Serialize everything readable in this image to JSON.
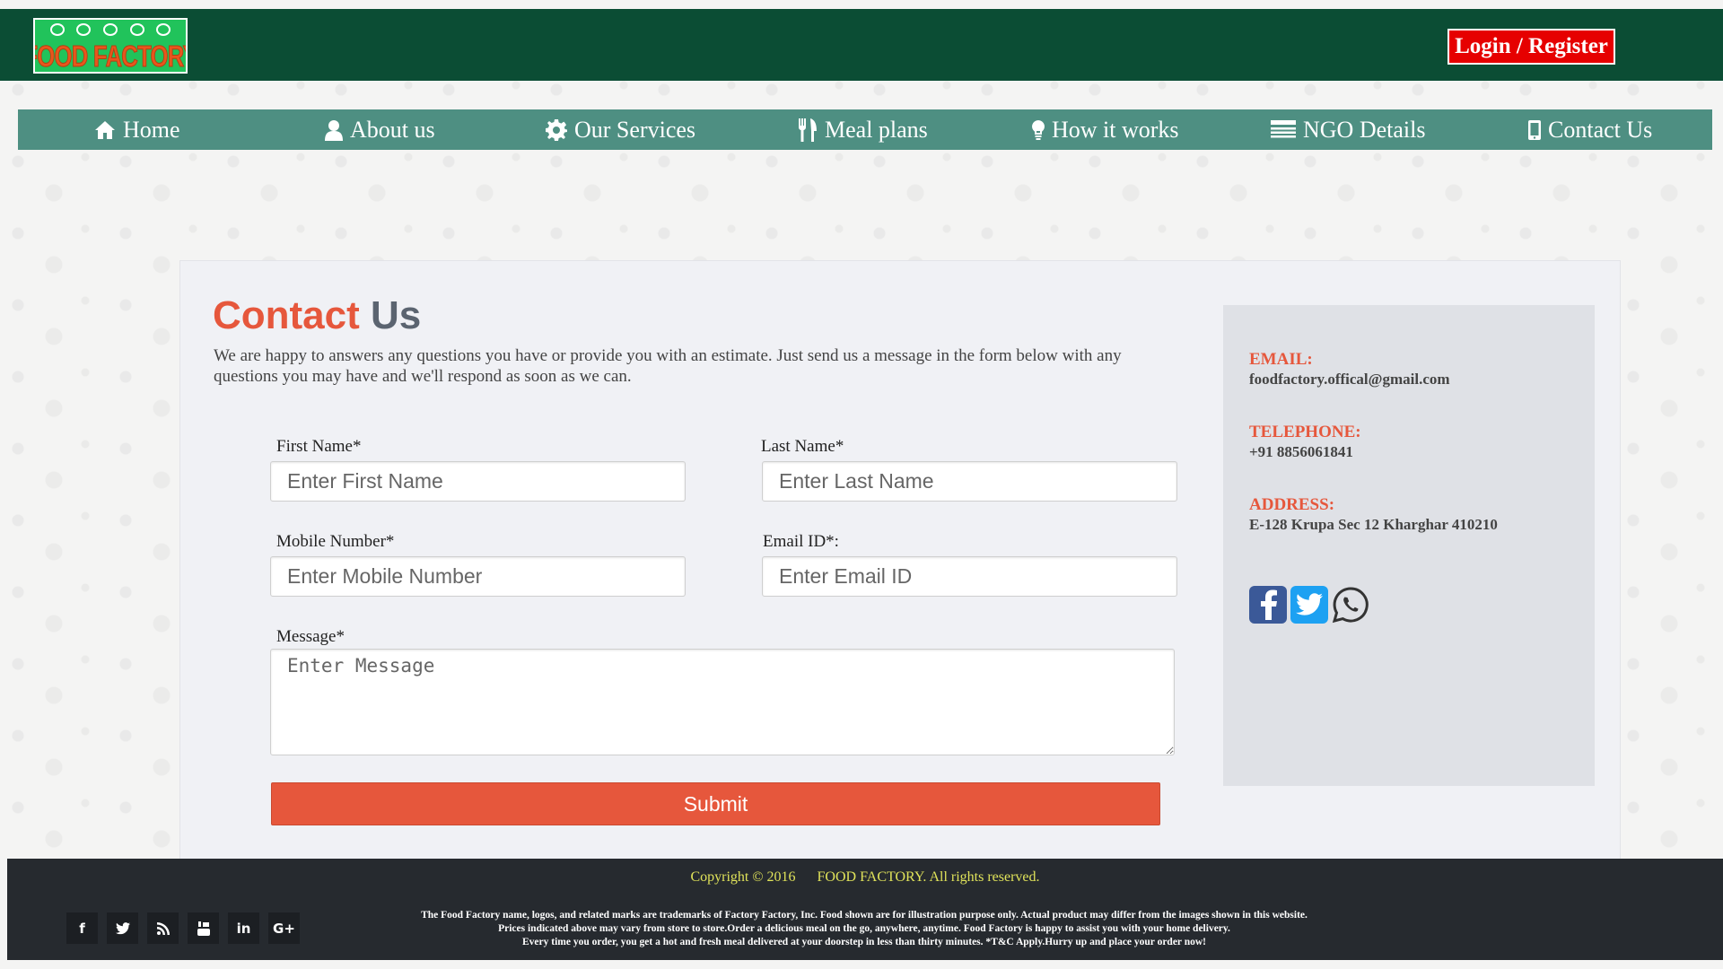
{
  "header": {
    "logo_text": "FOOD FACTORY",
    "login_label": "Login / Register"
  },
  "nav": {
    "items": [
      {
        "label": "Home",
        "icon": "home-icon"
      },
      {
        "label": "About us",
        "icon": "user-icon"
      },
      {
        "label": "Our Services",
        "icon": "gear-icon"
      },
      {
        "label": "Meal plans",
        "icon": "cutlery-icon"
      },
      {
        "label": "How it works",
        "icon": "lightbulb-icon"
      },
      {
        "label": "NGO Details",
        "icon": "list-icon"
      },
      {
        "label": "Contact Us",
        "icon": "mobile-icon"
      }
    ]
  },
  "contact": {
    "title_part1": "Contact",
    "title_part2": "Us",
    "intro": "We are happy to answers any questions you have or provide you with an estimate. Just send us a message in the form below with any questions you may have and we'll respond as soon as we can.",
    "first_name_label": "First Name*",
    "first_name_placeholder": "Enter First Name",
    "last_name_label": "Last Name*",
    "last_name_placeholder": "Enter Last Name",
    "mobile_label": "Mobile Number*",
    "mobile_placeholder": "Enter Mobile Number",
    "email_label": "Email ID*:",
    "email_placeholder": "Enter Email ID",
    "message_label": "Message*",
    "message_placeholder": "Enter Message",
    "submit_label": "Submit"
  },
  "info": {
    "email_heading": "EMAIL:",
    "email_value": "foodfactory.offical@gmail.com",
    "phone_heading": "TELEPHONE:",
    "phone_value": "+91 8856061841",
    "address_heading": "ADDRESS:",
    "address_value": "E-128 Krupa Sec 12 Kharghar 410210",
    "social_icons": [
      "facebook-icon",
      "twitter-icon",
      "whatsapp-icon"
    ]
  },
  "footer": {
    "copyright_part1": "Copyright © 2016",
    "copyright_part2": "FOOD FACTORY. All rights reserved.",
    "fine_line1": "The Food Factory name, logos, and related marks are trademarks of Factory Factory, Inc. Food shown are for illustration purpose only. Actual product may differ from the images shown in this website.",
    "fine_line2": "Prices indicated above may vary from store to store.Order a delicious meal on the go, anywhere, anytime. Food Factory is happy to assist you with your home delivery.",
    "fine_line3": "Every time you order, you get a hot and fresh meal delivered at your doorstep in less than thirty minutes. *T&C Apply.Hurry up and place your order now!",
    "social_icons": [
      "facebook-icon",
      "twitter-icon",
      "rss-icon",
      "youtube-icon",
      "linkedin-icon",
      "google-plus-icon"
    ],
    "gplus_text": "G+",
    "linkedin_text": "in",
    "facebook_text": "f"
  },
  "colors": {
    "header_bg": "#0b4d34",
    "nav_bg": "#4e8f82",
    "accent": "#e6573c",
    "login_bg": "#e60000",
    "footer_bg": "#262a2f",
    "copyright_text": "#e0e35a"
  }
}
